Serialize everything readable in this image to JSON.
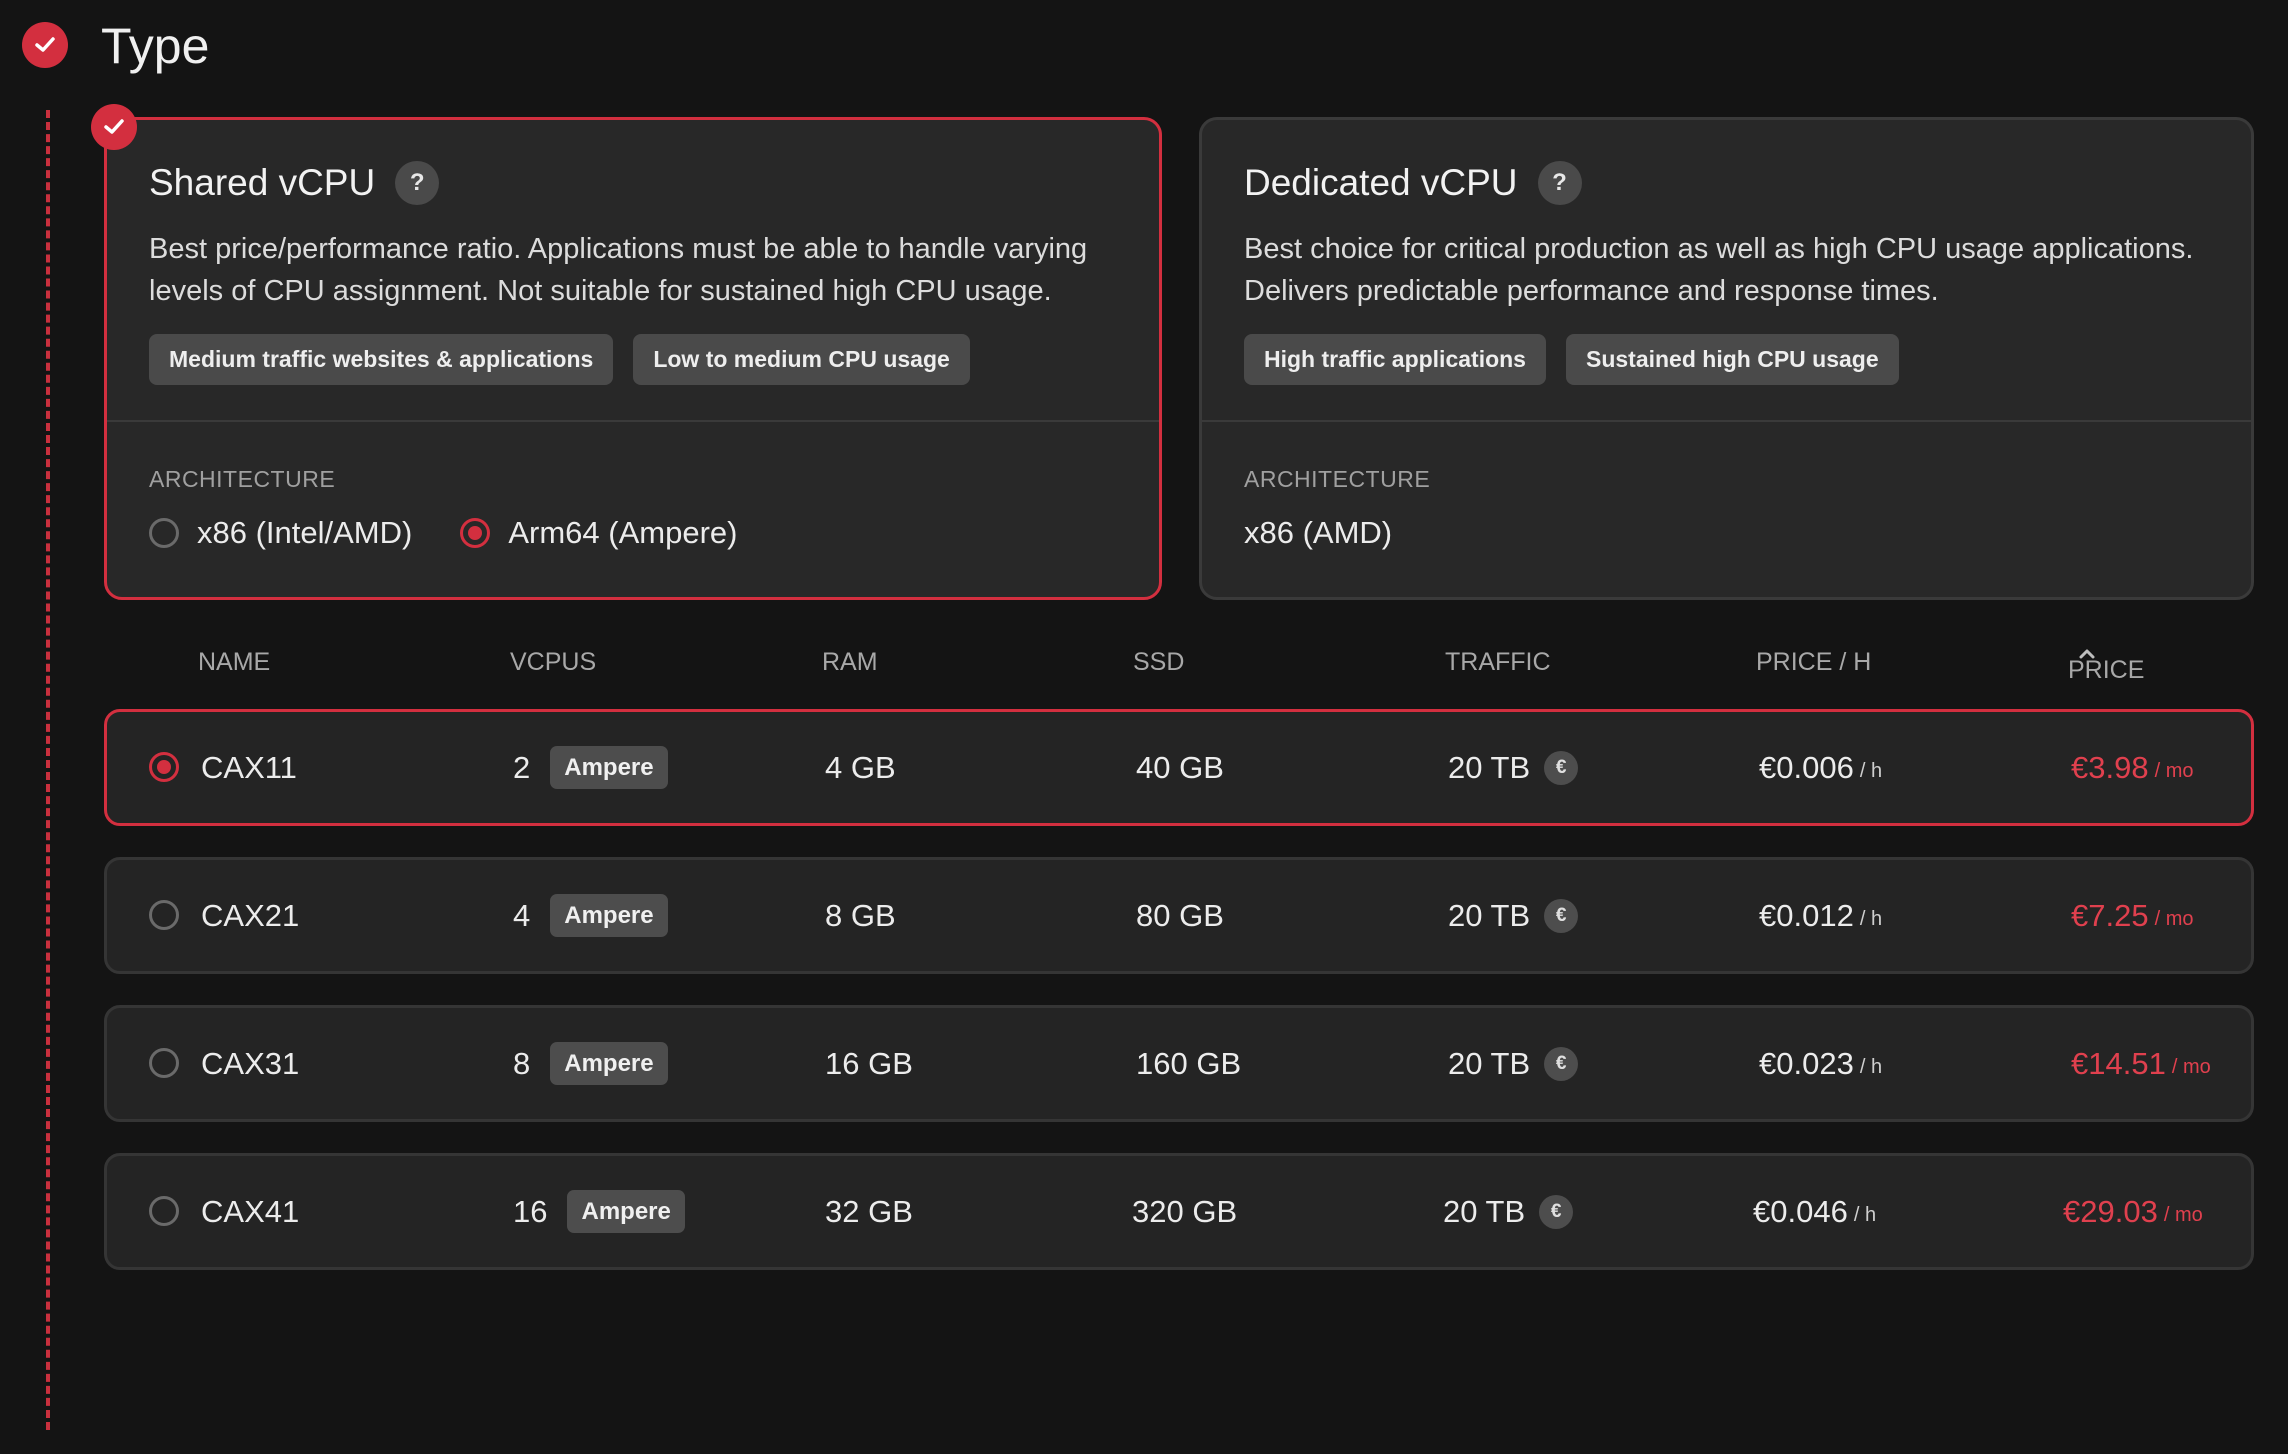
{
  "section": {
    "title": "Type"
  },
  "cards": [
    {
      "title": "Shared vCPU",
      "help": "?",
      "description": "Best price/performance ratio. Applications must be able to handle varying levels of CPU assignment. Not suitable for sustained high CPU usage.",
      "tags": [
        "Medium traffic websites & applications",
        "Low to medium CPU usage"
      ],
      "arch_label": "ARCHITECTURE",
      "arch_options": [
        {
          "label": "x86 (Intel/AMD)",
          "selected": false
        },
        {
          "label": "Arm64 (Ampere)",
          "selected": true
        }
      ],
      "selected": true
    },
    {
      "title": "Dedicated vCPU",
      "help": "?",
      "description": "Best choice for critical production as well as high CPU usage applications. Delivers predictable performance and response times.",
      "tags": [
        "High traffic applications",
        "Sustained high CPU usage"
      ],
      "arch_label": "ARCHITECTURE",
      "arch_value": "x86 (AMD)",
      "selected": false
    }
  ],
  "table": {
    "headers": {
      "name": "NAME",
      "vcpus": "VCPUS",
      "ram": "RAM",
      "ssd": "SSD",
      "traffic": "TRAFFIC",
      "price_h": "PRICE / H",
      "price": "PRICE"
    },
    "euro_icon": "€",
    "hour_unit": "/ h",
    "month_unit": "/ mo",
    "rows": [
      {
        "name": "CAX11",
        "vcpus": "2",
        "cpu_tag": "Ampere",
        "ram": "4 GB",
        "ssd": "40 GB",
        "traffic": "20 TB",
        "price_h": "€0.006",
        "price": "€3.98",
        "selected": true
      },
      {
        "name": "CAX21",
        "vcpus": "4",
        "cpu_tag": "Ampere",
        "ram": "8 GB",
        "ssd": "80 GB",
        "traffic": "20 TB",
        "price_h": "€0.012",
        "price": "€7.25",
        "selected": false
      },
      {
        "name": "CAX31",
        "vcpus": "8",
        "cpu_tag": "Ampere",
        "ram": "16 GB",
        "ssd": "160 GB",
        "traffic": "20 TB",
        "price_h": "€0.023",
        "price": "€14.51",
        "selected": false
      },
      {
        "name": "CAX41",
        "vcpus": "16",
        "cpu_tag": "Ampere",
        "ram": "32 GB",
        "ssd": "320 GB",
        "traffic": "20 TB",
        "price_h": "€0.046",
        "price": "€29.03",
        "selected": false
      }
    ]
  },
  "colors": {
    "accent": "#d32f3f",
    "background": "#141414",
    "card": "#282828"
  }
}
